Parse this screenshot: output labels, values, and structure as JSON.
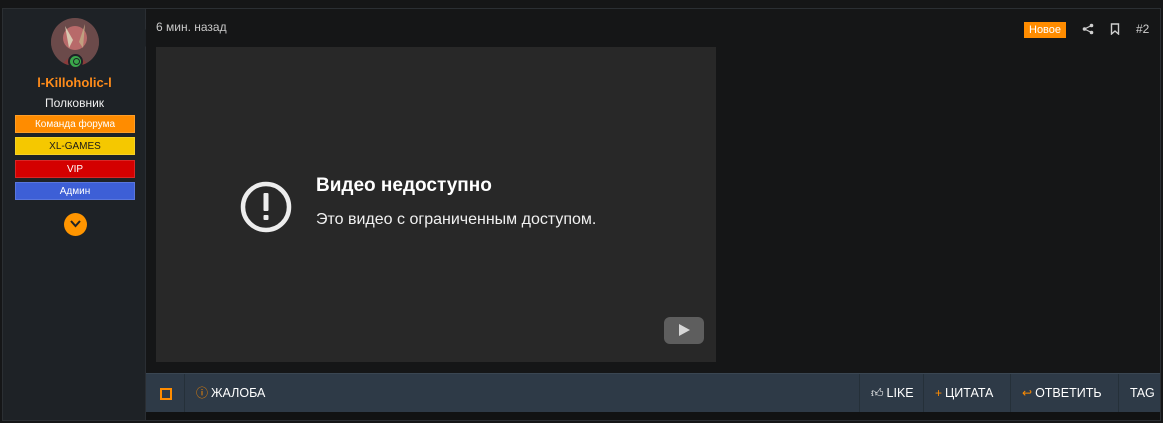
{
  "user": {
    "name": "l-Killoholic-l",
    "title": "Полковник",
    "badges": [
      "Команда форума",
      "XL-GAMES",
      "VIP",
      "Админ"
    ],
    "avatar_icon": "user-avatar-image",
    "online_icon": "online-status-icon",
    "more_icon": "chevron-down-icon"
  },
  "post": {
    "time": "6 мин. назад",
    "new_label": "Новое",
    "number": "#2",
    "share_icon": "share-icon",
    "bookmark_icon": "bookmark-icon"
  },
  "video": {
    "title": "Видео недоступно",
    "message": "Это видео с ограниченным доступом."
  },
  "footer": {
    "report": "ЖАЛОБА",
    "like": "LIKE",
    "quote": "ЦИТАТА",
    "reply": "ОТВЕТИТЬ",
    "tag": "TAG"
  },
  "colors": {
    "accent": "#ff8c00",
    "badge_team": "#ff8c00",
    "badge_xl": "#f5c800",
    "badge_vip": "#d40000",
    "badge_admin": "#3d5fd6",
    "footer_bg": "#2e3a47"
  }
}
